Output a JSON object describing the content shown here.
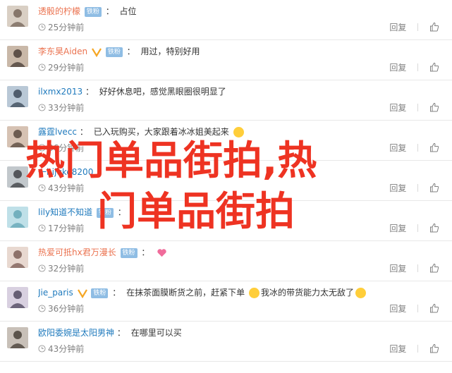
{
  "comments": [
    {
      "user": "透骰的柠檬",
      "badge": "铁粉",
      "sep": "：",
      "text": "占位",
      "time": "25分钟前",
      "emoji": null,
      "nameColor": "orange",
      "vip": false
    },
    {
      "user": "李东昊Aiden",
      "badge": "铁粉",
      "sep": "：",
      "text": "用过，特别好用",
      "time": "29分钟前",
      "emoji": null,
      "nameColor": "orange",
      "vip": true
    },
    {
      "user": "ilxmx2013",
      "badge": "",
      "sep": "：",
      "text": "好好休息吧，感觉黑眼圈很明显了",
      "time": "33分钟前",
      "emoji": null,
      "nameColor": "blue",
      "vip": false
    },
    {
      "user": "露霆lvecc",
      "badge": "",
      "sep": "：",
      "text": "已入玩购买，大家跟着冰冰姐美起来",
      "time": "36分钟前",
      "emoji": "grin",
      "nameColor": "blue",
      "vip": false
    },
    {
      "user": "一hijuke8200",
      "badge": "",
      "sep": "：",
      "text": "",
      "time": "43分钟前",
      "emoji": null,
      "nameColor": "blue",
      "vip": false
    },
    {
      "user": "lily知道不知道",
      "badge": "铁粉",
      "sep": "：",
      "text": "",
      "time": "17分钟前",
      "emoji": null,
      "nameColor": "blue",
      "vip": false
    },
    {
      "user": "热爱可抵hx君万漫长",
      "badge": "铁粉",
      "sep": "：",
      "text": "",
      "time": "32分钟前",
      "emoji": "heart",
      "nameColor": "orange",
      "vip": false
    },
    {
      "user": "Jie_paris",
      "badge": "铁粉",
      "sep": "：",
      "text": "在抹茶面膜断货之前，赶紧下单",
      "text2": "我冰的带货能力太无敌了",
      "time": "36分钟前",
      "emoji": "cat",
      "nameColor": "blue",
      "vip": true
    },
    {
      "user": "欧阳委婉是太阳男神",
      "badge": "",
      "sep": "：",
      "text": "在哪里可以买",
      "time": "43分钟前",
      "emoji": null,
      "nameColor": "blue",
      "vip": false
    }
  ],
  "actions": {
    "reply": "回复",
    "like": "赞"
  },
  "overlay": {
    "line1": "热门单品街拍,热",
    "line2": "门单品街拍"
  },
  "colors": {
    "orange": "#eb7350",
    "blue": "#1f7abd",
    "overlay": "#ee3322"
  }
}
